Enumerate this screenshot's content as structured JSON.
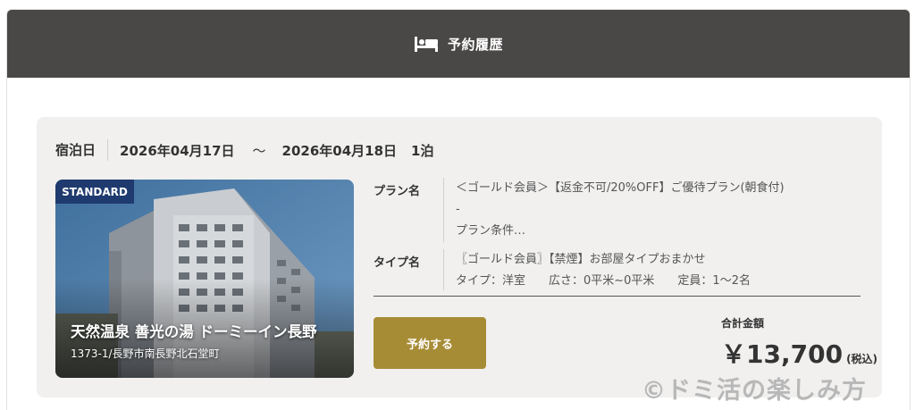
{
  "header": {
    "title": "予約履歴",
    "icon": "bed-icon"
  },
  "stay": {
    "label": "宿泊日",
    "checkin": "2026年04月17日",
    "separator": "〜",
    "checkout": "2026年04月18日",
    "nights": "1泊"
  },
  "hotel": {
    "badge": "STANDARD",
    "name": "天然温泉 善光の湯 ドーミーイン長野",
    "address": "1373-1/長野市南長野北石堂町"
  },
  "plan": {
    "label": "プラン名",
    "line1": "＜ゴールド会員＞【返金不可/20%OFF】ご優待プラン(朝食付)",
    "line2": "-",
    "line3": "プラン条件…"
  },
  "room": {
    "label": "タイプ名",
    "line1": "〖ゴールド会員〗【禁煙】お部屋タイプおまかせ",
    "line2": "タイプ：洋室　　広さ：0平米~0平米　　定員：1～2名"
  },
  "actions": {
    "reserve_label": "予約する"
  },
  "total": {
    "label": "合計金額",
    "price": "￥13,700",
    "tax": "(税込)"
  },
  "watermark": "©ドミ活の楽しみ方",
  "colors": {
    "header_bg": "#4a4847",
    "button_gold": "#a78c36",
    "badge_navy": "#1f3a6e",
    "card_bg": "#f1f0ef"
  }
}
